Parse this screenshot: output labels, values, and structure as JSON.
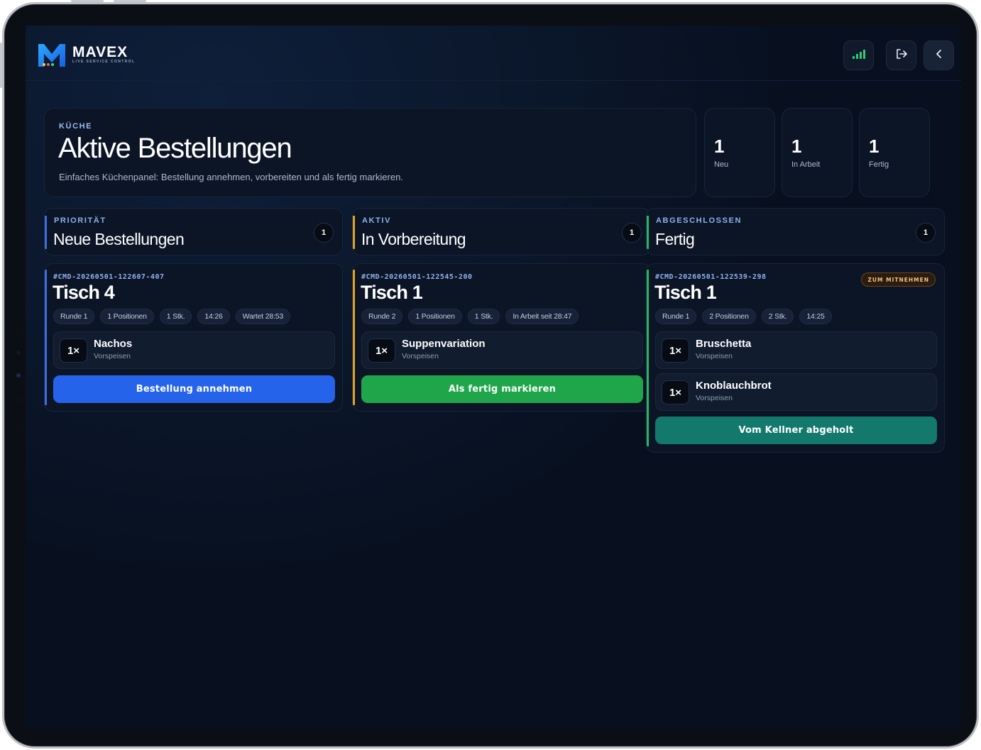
{
  "app": {
    "logo_name": "MAVEX",
    "logo_sub": "LIVE SERVICE CONTROL"
  },
  "header_icons": {
    "signal": "signal-bars-icon",
    "logout": "logout-icon",
    "back": "chevron-left-icon"
  },
  "hero": {
    "kicker": "KÜCHE",
    "title": "Aktive Bestellungen",
    "description": "Einfaches Küchenpanel: Bestellung annehmen, vorbereiten und als fertig markieren."
  },
  "stats": [
    {
      "value": "1",
      "label": "Neu"
    },
    {
      "value": "1",
      "label": "In Arbeit"
    },
    {
      "value": "1",
      "label": "Fertig"
    }
  ],
  "columns": [
    {
      "kicker": "PRIORITÄT",
      "title": "Neue Bestellungen",
      "count": "1",
      "accent": "#3b6fe8",
      "order": {
        "code": "#CMD-20260501-122607-407",
        "table": "Tisch 4",
        "chips": [
          "Runde 1",
          "1 Positionen",
          "1 Stk.",
          "14:26",
          "Wartet 28:53"
        ],
        "items": [
          {
            "qty": "1×",
            "name": "Nachos",
            "category": "Vorspeisen"
          }
        ],
        "action": "Bestellung annehmen",
        "action_color": "#2563eb"
      }
    },
    {
      "kicker": "AKTIV",
      "title": "In Vorbereitung",
      "count": "1",
      "accent": "#e0a528",
      "order": {
        "code": "#CMD-20260501-122545-200",
        "table": "Tisch 1",
        "chips": [
          "Runde 2",
          "1 Positionen",
          "1 Stk.",
          "In Arbeit seit 28:47"
        ],
        "items": [
          {
            "qty": "1×",
            "name": "Suppenvariation",
            "category": "Vorspeisen"
          }
        ],
        "action": "Als fertig markieren",
        "action_color": "#1fa64a"
      }
    },
    {
      "kicker": "ABGESCHLOSSEN",
      "title": "Fertig",
      "count": "1",
      "accent": "#22b865",
      "order": {
        "code": "#CMD-20260501-122539-298",
        "table": "Tisch 1",
        "badge": "ZUM MITNEHMEN",
        "chips": [
          "Runde 1",
          "2 Positionen",
          "2 Stk.",
          "14:25"
        ],
        "items": [
          {
            "qty": "1×",
            "name": "Bruschetta",
            "category": "Vorspeisen"
          },
          {
            "qty": "1×",
            "name": "Knoblauchbrot",
            "category": "Vorspeisen"
          }
        ],
        "action": "Vom Kellner abgeholt",
        "action_color": "#13796c"
      }
    }
  ]
}
